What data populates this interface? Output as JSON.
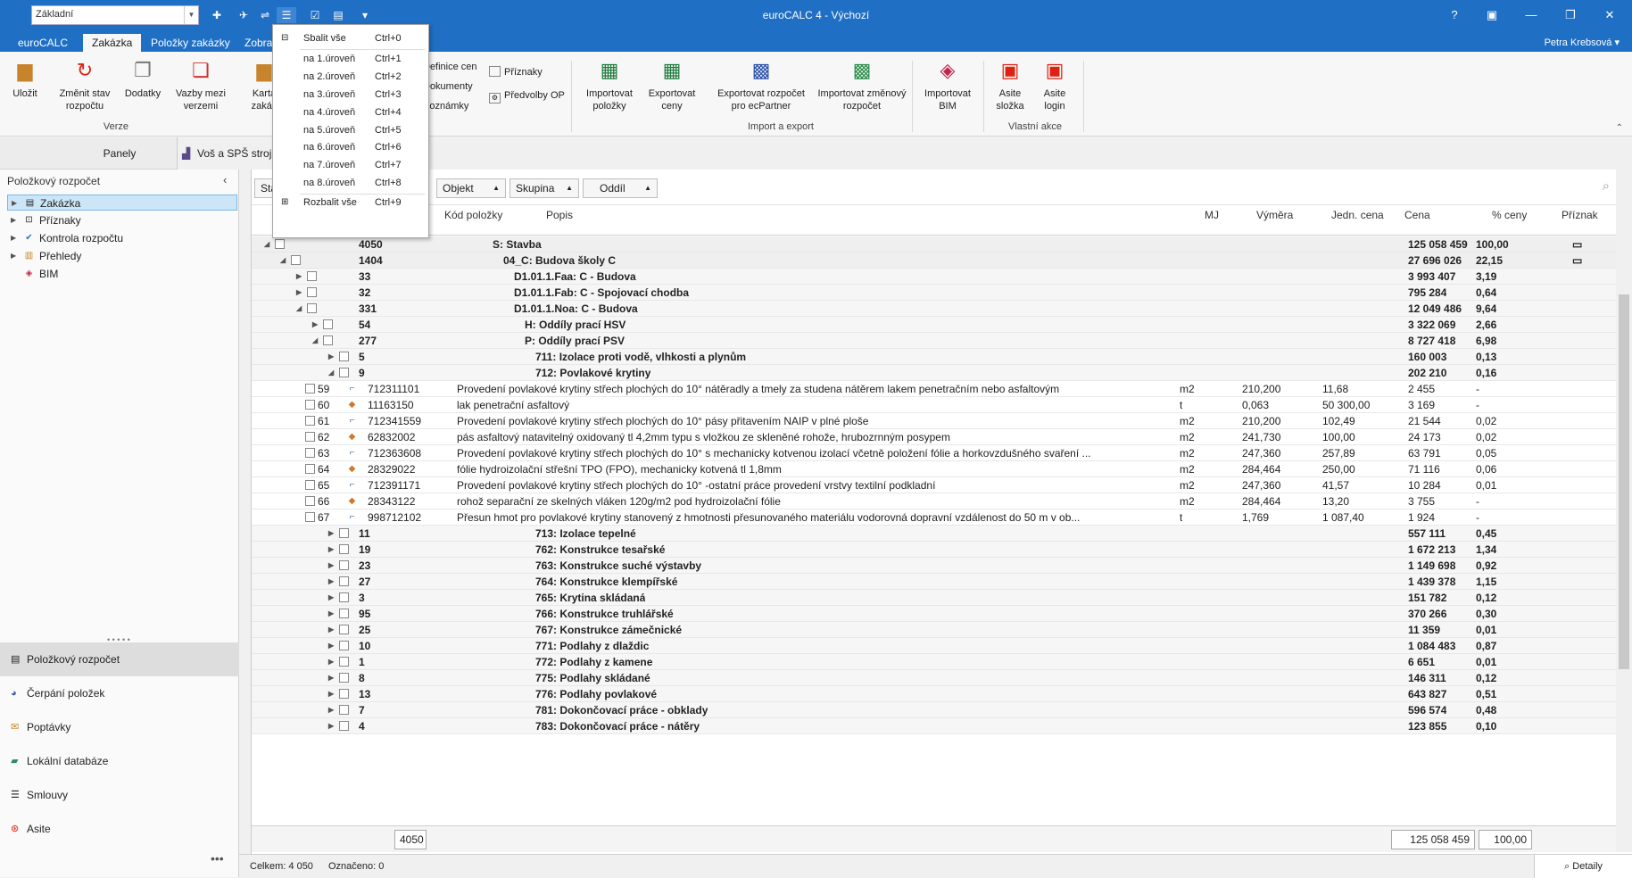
{
  "app": {
    "title": "euroCALC 4 - Výchozí",
    "view_combo": "Základní",
    "user": "Petra Krebsová"
  },
  "ribbon_tabs": [
    "euroCALC",
    "Zakázka",
    "Položky zakázky",
    "Zobraz"
  ],
  "ribbon": {
    "buttons": {
      "ulozit": "Uložit",
      "zmenit_stav": "Změnit stav rozpočtu",
      "dodatky": "Dodatky",
      "vazby": "Vazby mezi verzemi",
      "karta": "Karta zakáz",
      "import_polozky": "Importovat položky",
      "export_ceny": "Exportovat ceny",
      "export_ecpartner": "Exportovat rozpočet pro ecPartner",
      "import_zmenovy": "Importovat změnový rozpočet",
      "import_bim": "Importovat BIM",
      "asite_slozka": "Asite složka",
      "asite_login": "Asite login"
    },
    "small": {
      "definice_cen": "Definice cen",
      "dokumenty": "Dokumenty",
      "poznamky": "Poznámky",
      "priznaky": "Příznaky",
      "predvolby": "Předvolby OP"
    },
    "groups": {
      "verze": "Verze",
      "import_export": "Import a export",
      "vlastni": "Vlastní akce"
    }
  },
  "popup_menu": [
    {
      "label": "Sbalit vše",
      "key": "Ctrl+0"
    },
    {
      "label": "na 1.úroveň",
      "key": "Ctrl+1"
    },
    {
      "label": "na 2.úroveň",
      "key": "Ctrl+2"
    },
    {
      "label": "na 3.úroveň",
      "key": "Ctrl+3"
    },
    {
      "label": "na 4.úroveň",
      "key": "Ctrl+4"
    },
    {
      "label": "na 5.úroveň",
      "key": "Ctrl+5"
    },
    {
      "label": "na 6.úroveň",
      "key": "Ctrl+6"
    },
    {
      "label": "na 7.úroveň",
      "key": "Ctrl+7"
    },
    {
      "label": "na 8.úroveň",
      "key": "Ctrl+8"
    },
    {
      "label": "Rozbalit vše",
      "key": "Ctrl+9"
    }
  ],
  "left_panel": {
    "title": "Panely",
    "tree_title": "Položkový rozpočet",
    "tree": [
      "Zakázka",
      "Příznaky",
      "Kontrola rozpočtu",
      "Přehledy",
      "BIM"
    ],
    "nav": [
      "Položkový rozpočet",
      "Čerpání položek",
      "Poptávky",
      "Lokální databáze",
      "Smlouvy",
      "Asite"
    ]
  },
  "doc_tab": "Voš a SPŠ stroj",
  "group_chips": [
    "Sta",
    "Objekt",
    "Skupina",
    "Oddíl"
  ],
  "columns": {
    "kod": "Kód položky",
    "popis": "Popis",
    "mj": "MJ",
    "vymera": "Výměra",
    "jedn_cena": "Jedn. cena",
    "cena": "Cena",
    "pct": "% ceny",
    "priznak": "Příznak"
  },
  "rows": [
    {
      "t": "g",
      "lvl": 0,
      "n": "4050",
      "d": "S: Stavba",
      "cena": "125 058 459",
      "pct": "100,00"
    },
    {
      "t": "g",
      "lvl": 1,
      "n": "1404",
      "d": "04_C: Budova školy C",
      "cena": "27 696 026",
      "pct": "22,15"
    },
    {
      "t": "g",
      "lvl": 2,
      "n": "33",
      "d": "D1.01.1.Faa: C - Budova",
      "cena": "3 993 407",
      "pct": "3,19"
    },
    {
      "t": "g",
      "lvl": 2,
      "n": "32",
      "d": "D1.01.1.Fab: C - Spojovací chodba",
      "cena": "795 284",
      "pct": "0,64"
    },
    {
      "t": "g",
      "lvl": 2,
      "n": "331",
      "d": "D1.01.1.Noa: C - Budova",
      "cena": "12 049 486",
      "pct": "9,64"
    },
    {
      "t": "g",
      "lvl": 3,
      "n": "54",
      "d": "H: Oddíly prací HSV",
      "cena": "3 322 069",
      "pct": "2,66"
    },
    {
      "t": "g",
      "lvl": 3,
      "n": "277",
      "d": "P: Oddíly prací PSV",
      "cena": "8 727 418",
      "pct": "6,98"
    },
    {
      "t": "g",
      "lvl": 4,
      "n": "5",
      "d": "711: Izolace proti vodě, vlhkosti a plynům",
      "cena": "160 003",
      "pct": "0,13"
    },
    {
      "t": "g",
      "lvl": 4,
      "n": "9",
      "d": "712: Povlakové krytiny",
      "cena": "202 210",
      "pct": "0,16"
    },
    {
      "t": "i",
      "n": "59",
      "k": "712311101",
      "d": "Provedení povlakové krytiny střech plochých do 10° nátěradly a tmely za studena nátěrem lakem penetračním nebo asfaltovým",
      "mj": "m2",
      "v": "210,200",
      "j": "11,68",
      "cena": "2 455",
      "pct": "-"
    },
    {
      "t": "m",
      "n": "60",
      "k": "11163150",
      "d": "lak penetrační asfaltový",
      "mj": "t",
      "v": "0,063",
      "j": "50 300,00",
      "cena": "3 169",
      "pct": "-"
    },
    {
      "t": "i",
      "n": "61",
      "k": "712341559",
      "d": "Provedení povlakové krytiny střech plochých do 10° pásy přitavením NAIP v plné ploše",
      "mj": "m2",
      "v": "210,200",
      "j": "102,49",
      "cena": "21 544",
      "pct": "0,02"
    },
    {
      "t": "m",
      "n": "62",
      "k": "62832002",
      "d": "pás asfaltový natavitelný oxidovaný tl 4,2mm typu s vložkou ze skleněné rohože, hrubozrnným posypem",
      "mj": "m2",
      "v": "241,730",
      "j": "100,00",
      "cena": "24 173",
      "pct": "0,02"
    },
    {
      "t": "i",
      "n": "63",
      "k": "712363608",
      "d": "Provedení povlakové krytiny střech plochých do 10° s mechanicky kotvenou izolací včetně položení fólie a horkovzdušného svaření ...",
      "mj": "m2",
      "v": "247,360",
      "j": "257,89",
      "cena": "63 791",
      "pct": "0,05"
    },
    {
      "t": "m",
      "n": "64",
      "k": "28329022",
      "d": "fólie hydroizolační střešní TPO (FPO), mechanicky kotvená tl 1,8mm",
      "mj": "m2",
      "v": "284,464",
      "j": "250,00",
      "cena": "71 116",
      "pct": "0,06"
    },
    {
      "t": "i",
      "n": "65",
      "k": "712391171",
      "d": "Provedení povlakové krytiny střech plochých do 10° -ostatní práce provedení vrstvy textilní podkladní",
      "mj": "m2",
      "v": "247,360",
      "j": "41,57",
      "cena": "10 284",
      "pct": "0,01"
    },
    {
      "t": "m",
      "n": "66",
      "k": "28343122",
      "d": "rohož separační ze skelných vláken 120g/m2 pod hydroizolační fólie",
      "mj": "m2",
      "v": "284,464",
      "j": "13,20",
      "cena": "3 755",
      "pct": "-"
    },
    {
      "t": "i",
      "n": "67",
      "k": "998712102",
      "d": "Přesun hmot pro povlakové krytiny stanovený z hmotnosti přesunovaného materiálu vodorovná dopravní vzdálenost do 50 m v ob...",
      "mj": "t",
      "v": "1,769",
      "j": "1 087,40",
      "cena": "1 924",
      "pct": "-"
    },
    {
      "t": "g",
      "lvl": 4,
      "n": "11",
      "d": "713: Izolace tepelné",
      "cena": "557 111",
      "pct": "0,45"
    },
    {
      "t": "g",
      "lvl": 4,
      "n": "19",
      "d": "762: Konstrukce tesařské",
      "cena": "1 672 213",
      "pct": "1,34"
    },
    {
      "t": "g",
      "lvl": 4,
      "n": "23",
      "d": "763: Konstrukce suché výstavby",
      "cena": "1 149 698",
      "pct": "0,92"
    },
    {
      "t": "g",
      "lvl": 4,
      "n": "27",
      "d": "764: Konstrukce klempířské",
      "cena": "1 439 378",
      "pct": "1,15"
    },
    {
      "t": "g",
      "lvl": 4,
      "n": "3",
      "d": "765: Krytina skládaná",
      "cena": "151 782",
      "pct": "0,12"
    },
    {
      "t": "g",
      "lvl": 4,
      "n": "95",
      "d": "766: Konstrukce truhlářské",
      "cena": "370 266",
      "pct": "0,30"
    },
    {
      "t": "g",
      "lvl": 4,
      "n": "25",
      "d": "767: Konstrukce zámečnické",
      "cena": "11 359",
      "pct": "0,01"
    },
    {
      "t": "g",
      "lvl": 4,
      "n": "10",
      "d": "771: Podlahy z dlaždic",
      "cena": "1 084 483",
      "pct": "0,87"
    },
    {
      "t": "g",
      "lvl": 4,
      "n": "1",
      "d": "772: Podlahy z kamene",
      "cena": "6 651",
      "pct": "0,01"
    },
    {
      "t": "g",
      "lvl": 4,
      "n": "8",
      "d": "775: Podlahy skládané",
      "cena": "146 311",
      "pct": "0,12"
    },
    {
      "t": "g",
      "lvl": 4,
      "n": "13",
      "d": "776: Podlahy povlakové",
      "cena": "643 827",
      "pct": "0,51"
    },
    {
      "t": "g",
      "lvl": 4,
      "n": "7",
      "d": "781: Dokončovací práce - obklady",
      "cena": "596 574",
      "pct": "0,48"
    },
    {
      "t": "g",
      "lvl": 4,
      "n": "4",
      "d": "783: Dokončovací práce - nátěry",
      "cena": "123 855",
      "pct": "0,10"
    }
  ],
  "footer": {
    "count": "4050",
    "total": "125 058 459",
    "pct": "100,00"
  },
  "status": {
    "celkem": "Celkem: 4 050",
    "oznaceno": "Označeno: 0",
    "detaily": "Detaily"
  },
  "colors": {
    "titlebar": "#1f6fc4",
    "selection": "#cde6f7"
  }
}
